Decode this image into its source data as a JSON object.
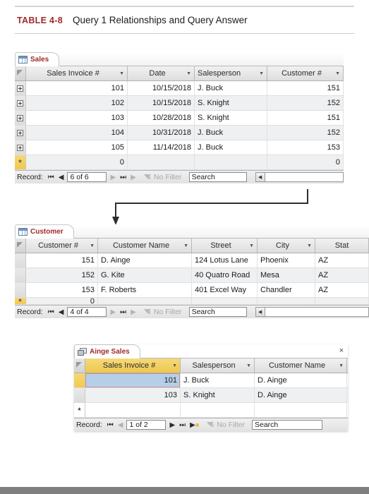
{
  "caption": {
    "number": "TABLE 4-8",
    "title": "Query 1 Relationships and Query Answer"
  },
  "colors": {
    "caption_number": "#9e2a28",
    "tab_label": "#9e2a28",
    "selected_header": "#edc84e",
    "selected_cell": "#b6cfe8",
    "footer_bar": "#7f7f7f"
  },
  "sales_window": {
    "tab": {
      "label": "Sales",
      "icon": "table-icon"
    },
    "columns": [
      {
        "label": "Sales Invoice #",
        "align": "num"
      },
      {
        "label": "Date",
        "align": "num"
      },
      {
        "label": "Salesperson",
        "align": "text"
      },
      {
        "label": "Customer #",
        "align": "num"
      }
    ],
    "rows": [
      {
        "invoice": "101",
        "date": "10/15/2018",
        "salesperson": "J. Buck",
        "customer": "151"
      },
      {
        "invoice": "102",
        "date": "10/15/2018",
        "salesperson": "S. Knight",
        "customer": "152"
      },
      {
        "invoice": "103",
        "date": "10/28/2018",
        "salesperson": "S. Knight",
        "customer": "151"
      },
      {
        "invoice": "104",
        "date": "10/31/2018",
        "salesperson": "J. Buck",
        "customer": "152"
      },
      {
        "invoice": "105",
        "date": "11/14/2018",
        "salesperson": "J. Buck",
        "customer": "153"
      }
    ],
    "new_row": {
      "invoice": "0",
      "date": "",
      "salesperson": "",
      "customer": "0",
      "marker": "*"
    },
    "nav": {
      "label": "Record:",
      "first": "⏮",
      "prev": "◀",
      "position": "6 of 6",
      "next": "▶",
      "last": "⏭",
      "new": "▶",
      "filter": "No Filter",
      "search_value": "Search"
    }
  },
  "customer_window": {
    "tab": {
      "label": "Customer",
      "icon": "table-icon"
    },
    "columns": [
      {
        "label": "Customer #",
        "align": "num"
      },
      {
        "label": "Customer Name",
        "align": "text"
      },
      {
        "label": "Street",
        "align": "text"
      },
      {
        "label": "City",
        "align": "text"
      },
      {
        "label": "Stat",
        "align": "text"
      }
    ],
    "rows": [
      {
        "customer": "151",
        "name": "D. Ainge",
        "street": "124 Lotus Lane",
        "city": "Phoenix",
        "state": "AZ"
      },
      {
        "customer": "152",
        "name": "G. Kite",
        "street": "40 Quatro Road",
        "city": "Mesa",
        "state": "AZ"
      },
      {
        "customer": "153",
        "name": "F. Roberts",
        "street": "401 Excel Way",
        "city": "Chandler",
        "state": "AZ"
      }
    ],
    "new_row": {
      "customer": "0",
      "marker": "*"
    },
    "nav": {
      "label": "Record:",
      "first": "⏮",
      "prev": "◀",
      "position": "4 of 4",
      "next": "▶",
      "last": "⏭",
      "new": "▶",
      "filter": "No Filter",
      "search_value": "Search"
    }
  },
  "query_window": {
    "tab": {
      "label": "Ainge Sales",
      "icon": "query-icon"
    },
    "close_label": "×",
    "columns": [
      {
        "label": "Sales Invoice #",
        "align": "num",
        "selected": true
      },
      {
        "label": "Salesperson",
        "align": "text",
        "selected": false
      },
      {
        "label": "Customer Name",
        "align": "text",
        "selected": false
      }
    ],
    "rows": [
      {
        "invoice": "101",
        "salesperson": "J. Buck",
        "name": "D. Ainge",
        "selected": true
      },
      {
        "invoice": "103",
        "salesperson": "S. Knight",
        "name": "D. Ainge",
        "selected": false
      }
    ],
    "new_row": {
      "marker": "*"
    },
    "nav": {
      "label": "Record:",
      "first": "⏮",
      "prev": "◀",
      "position": "1 of 2",
      "next": "▶",
      "last": "⏭",
      "new": "▶",
      "filter": "No Filter",
      "search_value": "Search"
    }
  },
  "connector": {
    "name": "relationship-arrow",
    "description": "arrow from Sales table to Customer table"
  }
}
